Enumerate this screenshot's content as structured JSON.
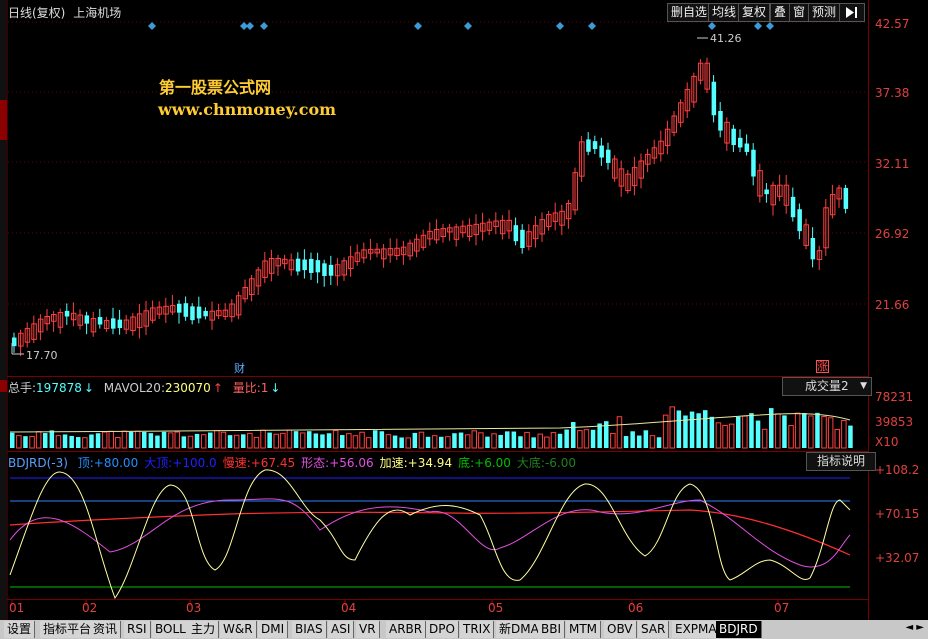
{
  "title": {
    "period": "日线(复权)",
    "stock": "上海机场"
  },
  "toolbar": [
    "删自选",
    "均线",
    "复权",
    "叠",
    "窗",
    "预测"
  ],
  "watermark": {
    "line1": "第一股票公式网",
    "line2": "www.chnmoney.com"
  },
  "price_axis": [
    "42.57",
    "37.38",
    "32.11",
    "26.92",
    "21.66"
  ],
  "price_marks": {
    "high": "41.26",
    "low": "17.70"
  },
  "event_marks": {
    "cai": "财",
    "zhang": "涨"
  },
  "volume_header": {
    "total_label": "总手:",
    "total_value": "197878",
    "mavol_label": "MAVOL20:",
    "mavol_value": "230070",
    "ratio_label": "量比:",
    "ratio_value": "1"
  },
  "volume_dropdown": "成交量2",
  "volume_axis": [
    "78231",
    "39853",
    "X10"
  ],
  "indicator_header": {
    "name": "BDJRD(-3)",
    "items": [
      {
        "label": "顶:",
        "value": "+80.00",
        "color": "#2090ff"
      },
      {
        "label": "大顶:",
        "value": "+100.0",
        "color": "#2020ff"
      },
      {
        "label": "慢速:",
        "value": "+67.45",
        "color": "#ff3030"
      },
      {
        "label": "形态:",
        "value": "+56.06",
        "color": "#e050e0"
      },
      {
        "label": "加速:",
        "value": "+34.94",
        "color": "#ffff80"
      },
      {
        "label": "底:",
        "value": "+6.00",
        "color": "#00c000"
      },
      {
        "label": "大底:",
        "value": "-6.00",
        "color": "#208020"
      }
    ]
  },
  "indicator_button": "指标说明",
  "indicator_axis": [
    "+108.2",
    "+70.15",
    "+32.07"
  ],
  "time_axis": [
    "01",
    "02",
    "03",
    "04",
    "05",
    "06",
    "07"
  ],
  "tabs": [
    "设置",
    "指标平台",
    "资讯",
    "RSI",
    "BOLL",
    "主力",
    "W&R",
    "DMI",
    "BIAS",
    "ASI",
    "VR",
    "ARBR",
    "DPO",
    "TRIX",
    "新DMA",
    "BBI",
    "MTM",
    "OBV",
    "SAR",
    "EXPMA",
    "BDJRD"
  ],
  "colors": {
    "up": "#ff4040",
    "down": "#54ffff",
    "axis": "#7a0000",
    "diamond": "#3a9bd8"
  }
}
